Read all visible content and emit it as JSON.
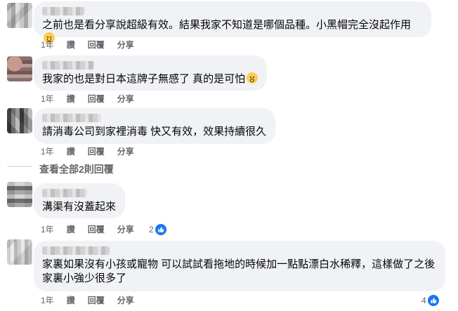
{
  "comments": [
    {
      "text": "之前也是看分享說超級有效。結果我家不知道是哪個品種。小黑帽完全沒起作用",
      "age": "1年",
      "like": "讚",
      "reply": "回覆",
      "share": "分享",
      "emoji": "crying-face-emoji"
    },
    {
      "text": "我家的也是對日本這牌子無感了 真的是可怕",
      "age": "1年",
      "like": "讚",
      "reply": "回覆",
      "share": "分享",
      "emoji": "screaming-face-emoji"
    },
    {
      "text": "請消毒公司到家裡消毒 快又有效，效果持續很久",
      "age": "1年",
      "like": "讚",
      "reply": "回覆",
      "share": "分享"
    },
    {
      "text": "溝渠有沒蓋起來",
      "age": "1年",
      "like": "讚",
      "reply": "回覆",
      "share": "分享",
      "reaction_count": "2"
    },
    {
      "text": "家裏如果沒有小孩或寵物 可以試試看拖地的時候加一點點漂白水稀釋，這樣做了之後\n家裏小強少很多了",
      "age": "1年",
      "like": "讚",
      "reply": "回覆",
      "share": "分享",
      "reaction_count": "4"
    }
  ],
  "view_replies": "查看全部2則回覆",
  "colors": {
    "bubble_bg": "#f0f2f5",
    "meta_text": "#65676b",
    "like_blue": "#1877f2"
  }
}
